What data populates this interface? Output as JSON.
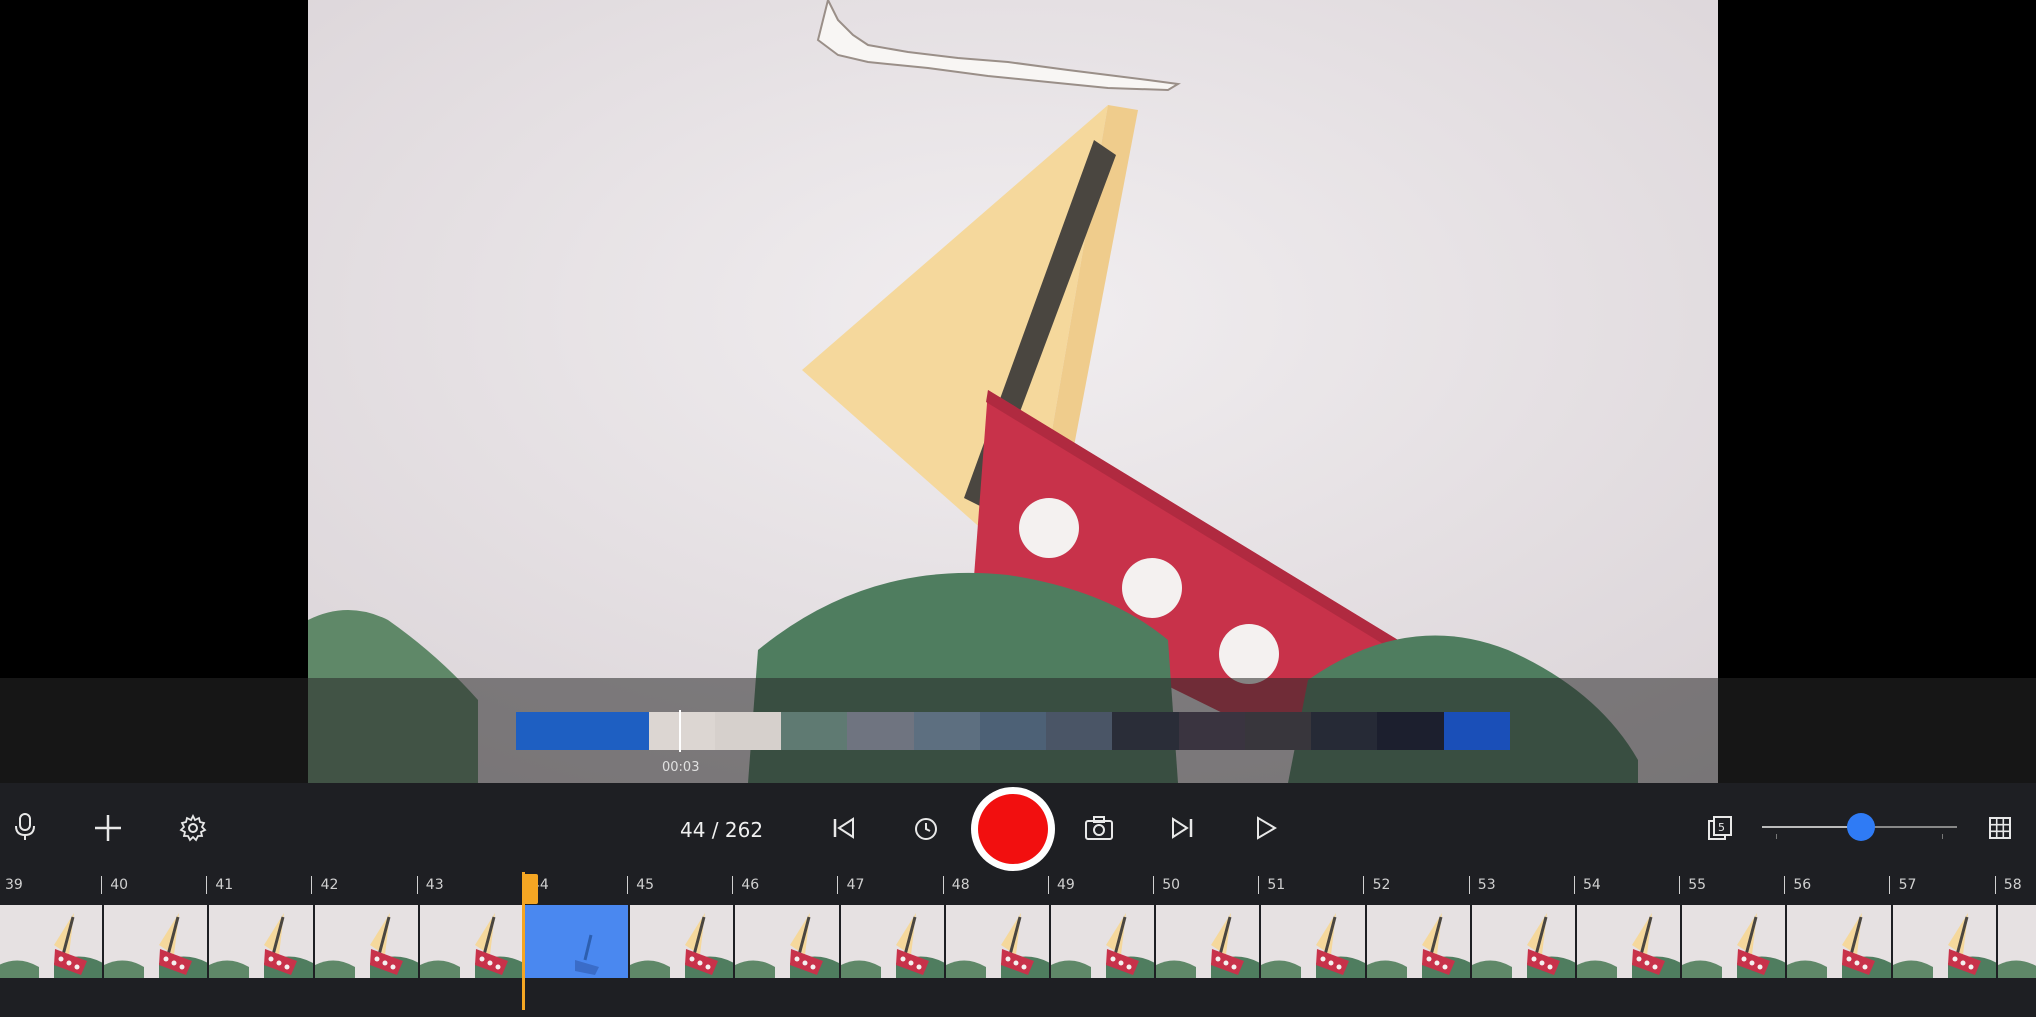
{
  "preview": {
    "subject": "paper cutout sailboat on waves"
  },
  "overview_strip": {
    "time_label": "00:03",
    "segments": [
      {
        "color": "#1e5fc2"
      },
      {
        "color": "#1e5fc2"
      },
      {
        "color": "#dcd6d2"
      },
      {
        "color": "#d6d0cc"
      },
      {
        "color": "#5f7a72"
      },
      {
        "color": "#6f7480"
      },
      {
        "color": "#5d6f80"
      },
      {
        "color": "#4d6176"
      },
      {
        "color": "#4a5566"
      },
      {
        "color": "#2a2d38"
      },
      {
        "color": "#3a3440"
      },
      {
        "color": "#38363c"
      },
      {
        "color": "#262a36"
      },
      {
        "color": "#1c1f2e"
      },
      {
        "color": "#1a4fb8"
      }
    ]
  },
  "toolbar": {
    "mic_icon": "microphone-icon",
    "add_icon": "plus-icon",
    "settings_icon": "gear-icon",
    "frame_counter": "44 / 262",
    "prev_icon": "skip-back-icon",
    "timer_icon": "clock-icon",
    "record_color": "#f20f0f",
    "camera_icon": "camera-icon",
    "next_icon": "skip-forward-icon",
    "play_icon": "play-icon",
    "onion_icon": "onion-skin-icon",
    "zoom_level": 0.5,
    "grid_icon": "grid-icon"
  },
  "timeline": {
    "accent": "#f5a623",
    "selected_color": "#4a88f0",
    "current_frame": 44,
    "labels": [
      "39",
      "40",
      "41",
      "42",
      "43",
      "44",
      "45",
      "46",
      "47",
      "48",
      "49",
      "50",
      "51",
      "52",
      "53",
      "54",
      "55",
      "56",
      "57",
      "58"
    ]
  }
}
